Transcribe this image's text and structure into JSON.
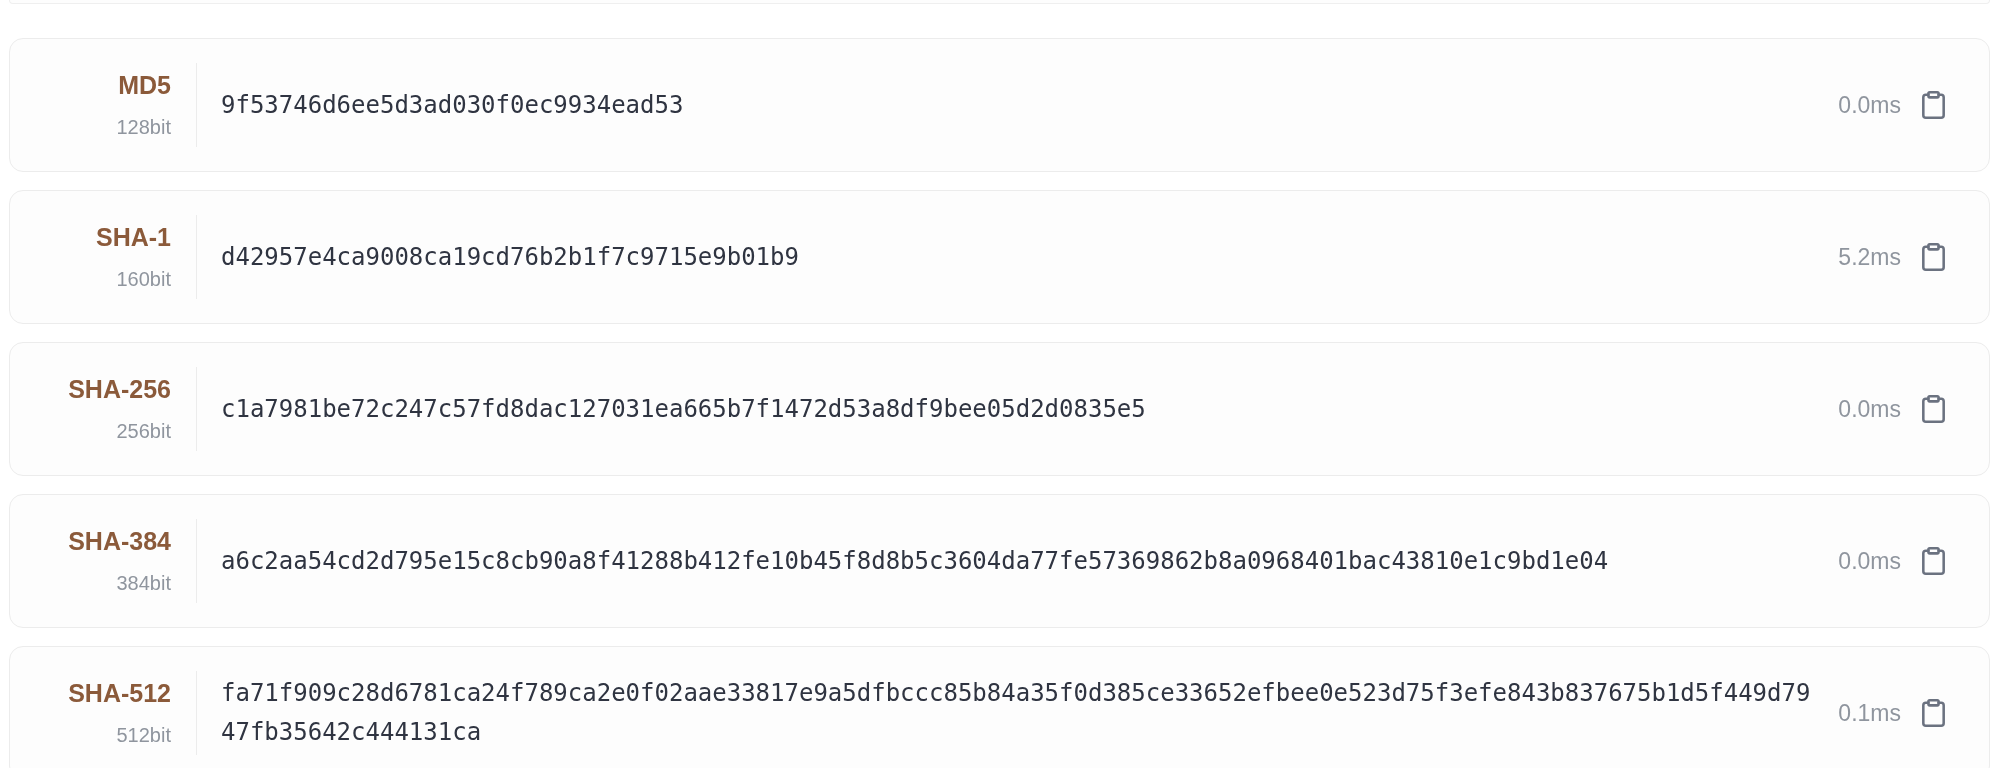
{
  "hashes": [
    {
      "algorithm": "MD5",
      "bits": "128bit",
      "digest": "9f53746d6ee5d3ad030f0ec9934ead53",
      "time": "0.0ms"
    },
    {
      "algorithm": "SHA-1",
      "bits": "160bit",
      "digest": "d42957e4ca9008ca19cd76b2b1f7c9715e9b01b9",
      "time": "5.2ms"
    },
    {
      "algorithm": "SHA-256",
      "bits": "256bit",
      "digest": "c1a7981be72c247c57fd8dac127031ea665b7f1472d53a8df9bee05d2d0835e5",
      "time": "0.0ms"
    },
    {
      "algorithm": "SHA-384",
      "bits": "384bit",
      "digest": "a6c2aa54cd2d795e15c8cb90a8f41288b412fe10b45f8d8b5c3604da77fe57369862b8a0968401bac43810e1c9bd1e04",
      "time": "0.0ms"
    },
    {
      "algorithm": "SHA-512",
      "bits": "512bit",
      "digest": "fa71f909c28d6781ca24f789ca2e0f02aae33817e9a5dfbccc85b84a35f0d385ce33652efbee0e523d75f3efe843b837675b1d5f449d7947fb35642c444131ca",
      "time": "0.1ms"
    }
  ]
}
